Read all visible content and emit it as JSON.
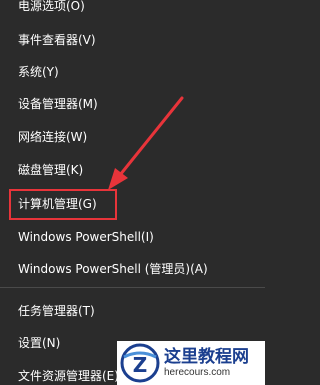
{
  "menu": {
    "items": [
      {
        "label": "电源选项(O)"
      },
      {
        "label": "事件查看器(V)"
      },
      {
        "label": "系统(Y)"
      },
      {
        "label": "设备管理器(M)"
      },
      {
        "label": "网络连接(W)"
      },
      {
        "label": "磁盘管理(K)"
      },
      {
        "label": "计算机管理(G)"
      },
      {
        "label": "Windows PowerShell(I)"
      },
      {
        "label": "Windows PowerShell (管理员)(A)"
      },
      {
        "label": "任务管理器(T)"
      },
      {
        "label": "设置(N)"
      },
      {
        "label": "文件资源管理器(E)"
      }
    ]
  },
  "annotation": {
    "highlight_color": "#e8343a",
    "arrow_color": "#e8343a"
  },
  "watermark": {
    "title": "这里教程网",
    "url": "herecours.com"
  },
  "colors": {
    "background": "#2b2b2b",
    "text": "#ffffff",
    "divider": "#4a4a4a"
  }
}
